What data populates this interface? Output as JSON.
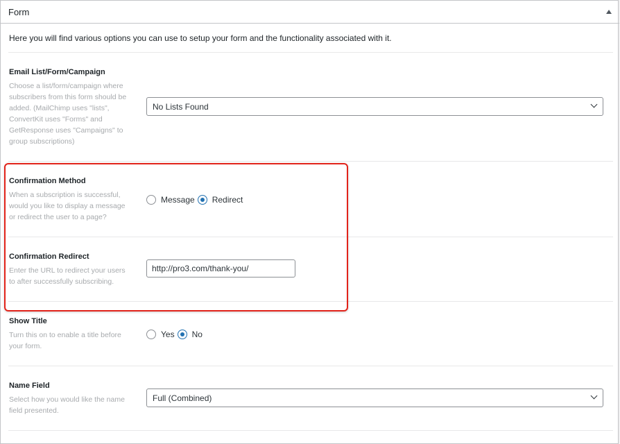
{
  "panel": {
    "title": "Form",
    "intro": "Here you will find various options you can use to setup your form and the functionality associated with it."
  },
  "fields": {
    "email_list": {
      "label": "Email List/Form/Campaign",
      "description": "Choose a list/form/campaign where subscribers from this form should be added. (MailChimp uses \"lists\", ConvertKit uses \"Forms\" and GetResponse uses \"Campaigns\" to group subscriptions)",
      "selected": "No Lists Found"
    },
    "confirmation_method": {
      "label": "Confirmation Method",
      "description": "When a subscription is successful, would you like to display a message or redirect the user to a page?",
      "options": [
        "Message",
        "Redirect"
      ],
      "selected": "Redirect"
    },
    "confirmation_redirect": {
      "label": "Confirmation Redirect",
      "description": "Enter the URL to redirect your users to after successfully subscribing.",
      "value": "http://pro3.com/thank-you/"
    },
    "show_title": {
      "label": "Show Title",
      "description": "Turn this on to enable a title before your form.",
      "options": [
        "Yes",
        "No"
      ],
      "selected": "No"
    },
    "name_field": {
      "label": "Name Field",
      "description": "Select how you would like the name field presented.",
      "selected": "Full (Combined)"
    }
  },
  "colors": {
    "accent": "#2271b1",
    "highlight": "#e2231a",
    "description_text": "#a7aaad"
  }
}
